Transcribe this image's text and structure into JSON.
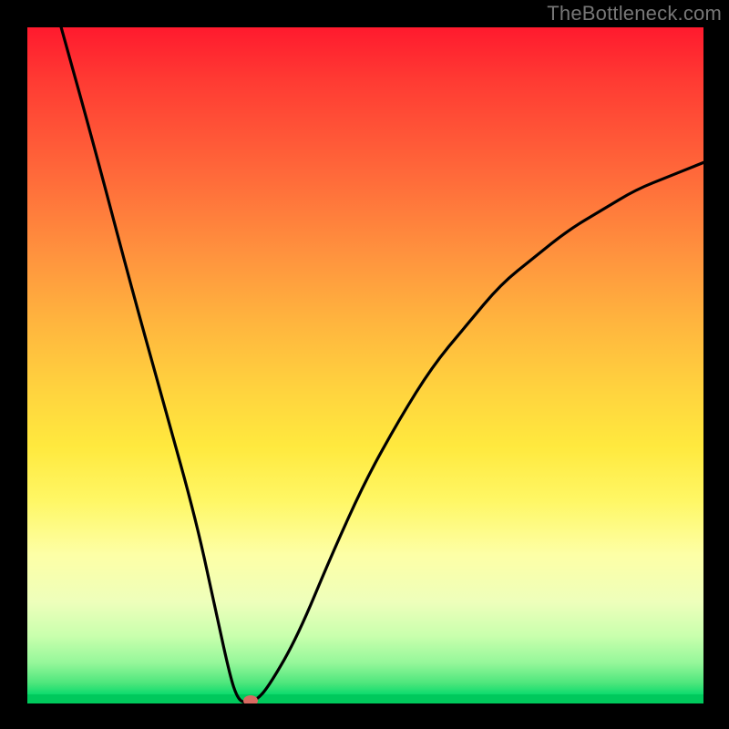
{
  "watermark": "TheBottleneck.com",
  "colors": {
    "frame": "#000000",
    "curve": "#000000",
    "marker": "#d96a61",
    "gradient_top": "#ff1a2e",
    "gradient_bottom": "#00c95c"
  },
  "chart_data": {
    "type": "line",
    "title": "",
    "xlabel": "",
    "ylabel": "",
    "xlim": [
      0,
      100
    ],
    "ylim": [
      0,
      100
    ],
    "grid": false,
    "legend": false,
    "notes": "V-shaped bottleneck curve over continuous rainbow gradient (red at top = bad fit, green at bottom = good fit). Minimum (optimal point) marked with a dot near bottom.",
    "series": [
      {
        "name": "bottleneck-curve",
        "x": [
          5,
          10,
          15,
          20,
          25,
          28,
          30,
          31,
          32,
          34,
          36,
          40,
          45,
          50,
          55,
          60,
          65,
          70,
          75,
          80,
          85,
          90,
          95,
          100
        ],
        "y": [
          100,
          82,
          63,
          45,
          27,
          13,
          4,
          1,
          0,
          0.5,
          3,
          10,
          22,
          33,
          42,
          50,
          56,
          62,
          66,
          70,
          73,
          76,
          78,
          80
        ]
      }
    ],
    "marker": {
      "x": 33,
      "y": 0,
      "label": "optimal-point"
    }
  }
}
